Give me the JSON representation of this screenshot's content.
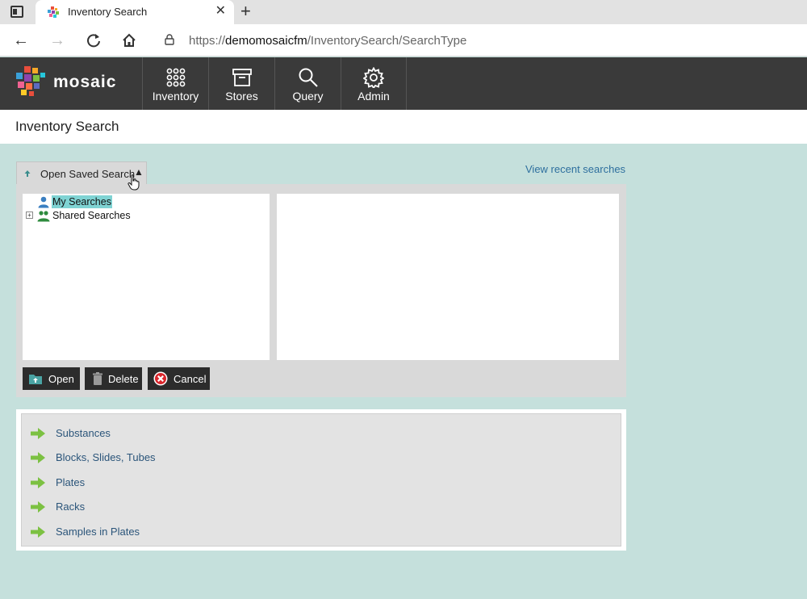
{
  "browser": {
    "tab_title": "Inventory Search",
    "url_prefix": "https://",
    "url_host": "demomosaicfm",
    "url_path": "/InventorySearch/SearchType"
  },
  "app": {
    "logo_text": "mosaic",
    "nav": [
      {
        "label": "Inventory",
        "icon": "grid-icon"
      },
      {
        "label": "Stores",
        "icon": "archive-box-icon"
      },
      {
        "label": "Query",
        "icon": "search-icon"
      },
      {
        "label": "Admin",
        "icon": "gear-icon"
      }
    ]
  },
  "page": {
    "title": "Inventory Search",
    "open_saved_search_label": "Open Saved Search",
    "view_recent_label": "View recent searches"
  },
  "saved_search": {
    "tree": [
      {
        "label": "My Searches",
        "selected": true,
        "expander": false
      },
      {
        "label": "Shared Searches",
        "selected": false,
        "expander": true
      }
    ],
    "buttons": {
      "open": "Open",
      "delete": "Delete",
      "cancel": "Cancel"
    }
  },
  "search_types": [
    "Substances",
    "Blocks, Slides, Tubes",
    "Plates",
    "Racks",
    "Samples in Plates"
  ],
  "colors": {
    "background": "#c5e0dc",
    "header": "#3a3a3a",
    "link": "#2e6f9e",
    "arrow": "#7cc142",
    "selection": "#7fd3d3"
  }
}
